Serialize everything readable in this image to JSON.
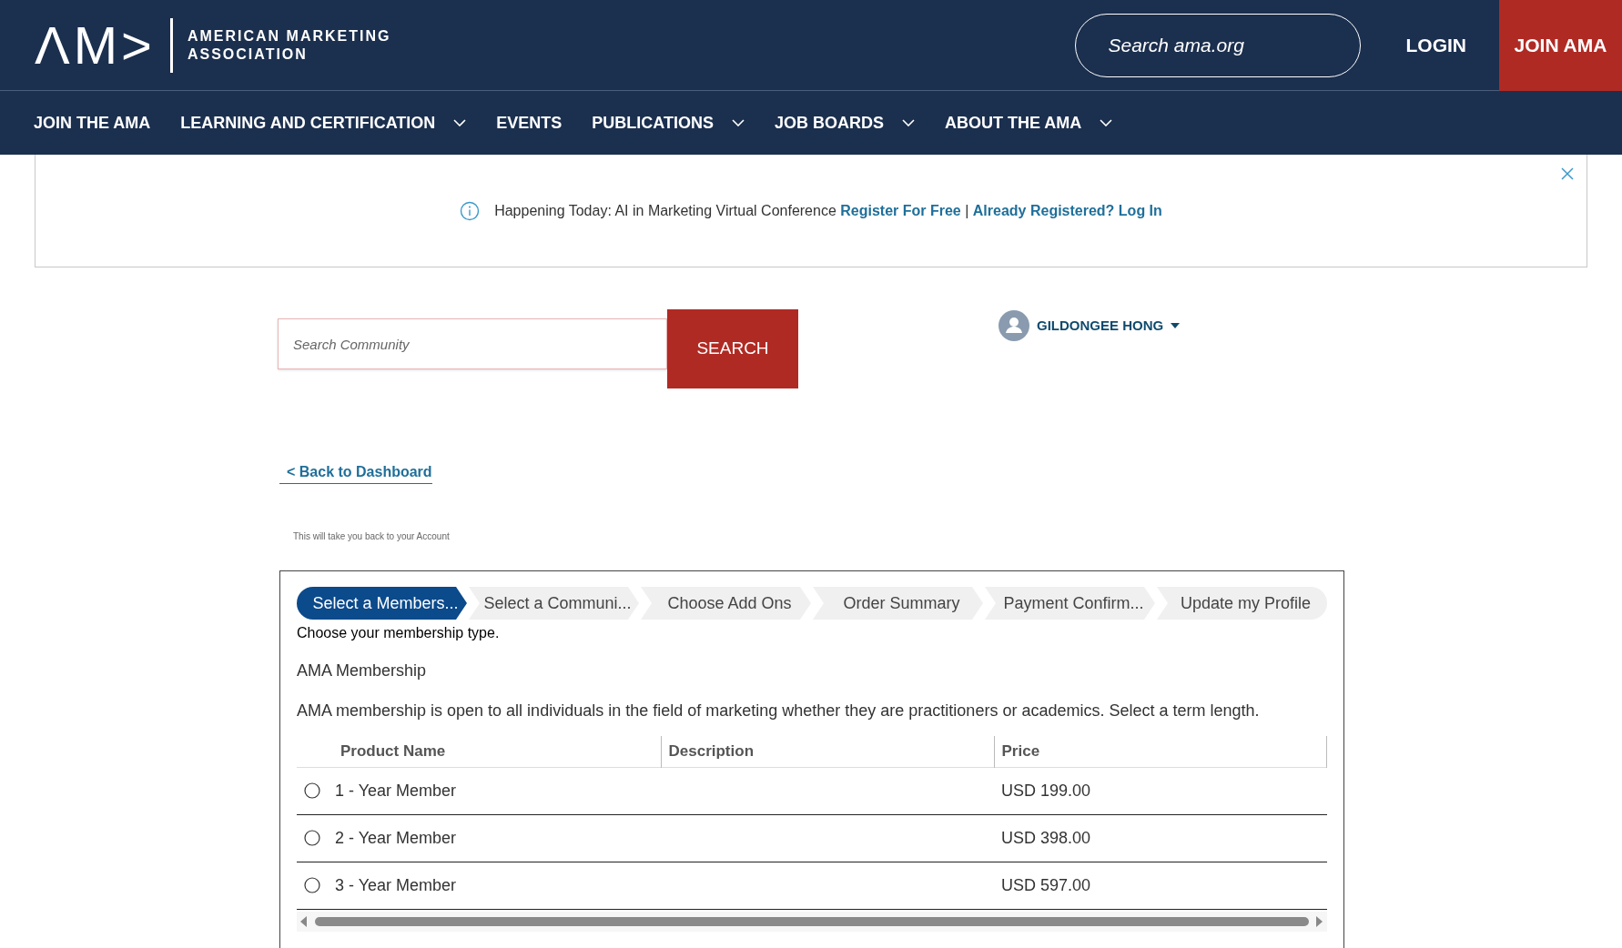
{
  "header": {
    "logo_mark": "ΛM>",
    "logo_text": [
      "AMERICAN MARKETING",
      "ASSOCIATION"
    ],
    "search": {
      "placeholder": "Search ama.org"
    },
    "login": "LOGIN",
    "join": "JOIN AMA"
  },
  "nav": [
    {
      "label": "JOIN THE AMA",
      "dropdown": false
    },
    {
      "label": "LEARNING AND CERTIFICATION",
      "dropdown": true
    },
    {
      "label": "EVENTS",
      "dropdown": false
    },
    {
      "label": "PUBLICATIONS",
      "dropdown": true
    },
    {
      "label": "JOB BOARDS",
      "dropdown": true
    },
    {
      "label": "ABOUT THE AMA",
      "dropdown": true
    }
  ],
  "banner": {
    "text": "Happening Today: AI in Marketing Virtual Conference",
    "link_1": "Register For Free",
    "separator": "|",
    "link_2": "Already Registered? Log In"
  },
  "community_search": {
    "placeholder": "Search Community",
    "button": "SEARCH"
  },
  "user_menu": {
    "name": "GILDONGEE HONG"
  },
  "back_link": "< Back to Dashboard",
  "back_hint": "This will take you back to your Account",
  "steps": [
    {
      "label": "Select a Members...",
      "selected": true
    },
    {
      "label": "Select a Communi...",
      "selected": false
    },
    {
      "label": "Choose Add Ons",
      "selected": false
    },
    {
      "label": "Order Summary",
      "selected": false
    },
    {
      "label": "Payment Confirm...",
      "selected": false
    },
    {
      "label": "Update my Profile",
      "selected": false
    }
  ],
  "instruction": "Choose your membership type.",
  "section_title": "AMA Membership",
  "section_text": "AMA membership is open to all individuals in the field of marketing whether they are practitioners or academics. Select a term length.",
  "table": {
    "columns": [
      "Product Name",
      "Description",
      "Price"
    ],
    "rows": [
      {
        "name": "1 - Year Member",
        "price": "USD 199.00",
        "selected": false
      },
      {
        "name": "2 - Year Member",
        "price": "USD 398.00",
        "selected": false
      },
      {
        "name": "3 - Year Member",
        "price": "USD 597.00",
        "selected": false
      }
    ]
  }
}
